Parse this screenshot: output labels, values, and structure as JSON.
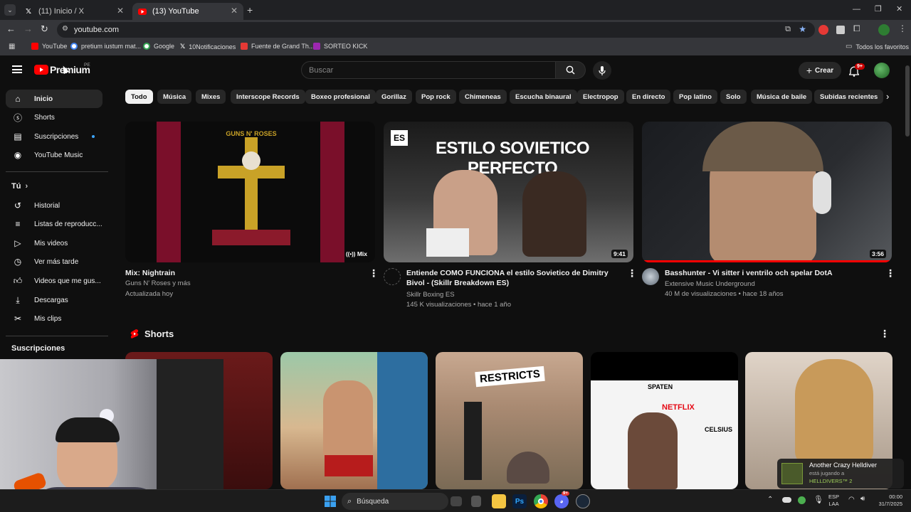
{
  "browser": {
    "tabs": [
      {
        "title": "(11) Inicio / X"
      },
      {
        "title": "(13) YouTube"
      }
    ],
    "new_tab_symbol": "+",
    "address": "youtube.com",
    "bookmarks": [
      {
        "label": "YouTube"
      },
      {
        "label": "pretium iustum mat..."
      },
      {
        "label": "Google"
      },
      {
        "label": "10Notificaciones"
      },
      {
        "label": "Fuente de Grand Th..."
      },
      {
        "label": "SORTEO KICK"
      }
    ],
    "all_bookmarks": "Todos los favoritos"
  },
  "youtube": {
    "logo_text": "Premium",
    "logo_region": "PE",
    "search_placeholder": "Buscar",
    "create_label": "Crear",
    "notif_badge": "9+",
    "sidebar": {
      "main": [
        {
          "label": "Inicio"
        },
        {
          "label": "Shorts"
        },
        {
          "label": "Suscripciones"
        },
        {
          "label": "YouTube Music"
        }
      ],
      "you_heading": "Tú",
      "you": [
        {
          "label": "Historial"
        },
        {
          "label": "Listas de reproducc..."
        },
        {
          "label": "Mis videos"
        },
        {
          "label": "Ver más tarde"
        },
        {
          "label": "Videos que me gus..."
        },
        {
          "label": "Descargas"
        },
        {
          "label": "Mis clips"
        }
      ],
      "subs_heading": "Suscripciones"
    },
    "chips": [
      "Todo",
      "Música",
      "Mixes",
      "Interscope Records",
      "Boxeo profesional",
      "Gorillaz",
      "Pop rock",
      "Chimeneas",
      "Escucha binaural",
      "Electropop",
      "En directo",
      "Pop latino",
      "Solo",
      "Música de baile",
      "Subidas recientes"
    ],
    "videos": [
      {
        "title": "Mix: Nightrain",
        "channel": "Guns N' Roses y más",
        "meta": "Actualizada hoy",
        "badge": "Mix",
        "thumb_text": "GUNS N' ROSES"
      },
      {
        "title": "Entiende COMO FUNCIONA el estilo Sovietico de Dimitry Bivol - (Skillr Breakdown ES)",
        "channel": "Skillr Boxing ES",
        "meta": "145 K visualizaciones • hace 1 año",
        "duration": "9:41",
        "thumb_text": "ESTILO SOVIETICO PERFECTO",
        "thumb_tag": "ES"
      },
      {
        "title": "Basshunter - Vi sitter i ventrilo och spelar DotA",
        "channel": "Extensive Music Underground",
        "meta": "40 M de visualizaciones • hace 18 años",
        "duration": "3:56"
      }
    ],
    "shorts_heading": "Shorts",
    "shorts_thumb_text": "RESTRICTS",
    "short_poster_words": [
      "SPATEN",
      "NETFLIX",
      "CELSIUS"
    ]
  },
  "toast": {
    "title": "Another Crazy Helldiver",
    "line1": "está jugando a",
    "line2": "HELLDIVERS™ 2"
  },
  "taskbar": {
    "search": "Búsqueda",
    "lang1": "ESP",
    "lang2": "LAA",
    "time": "00:00",
    "date": "31/7/2025",
    "discord_badge": "9+"
  }
}
